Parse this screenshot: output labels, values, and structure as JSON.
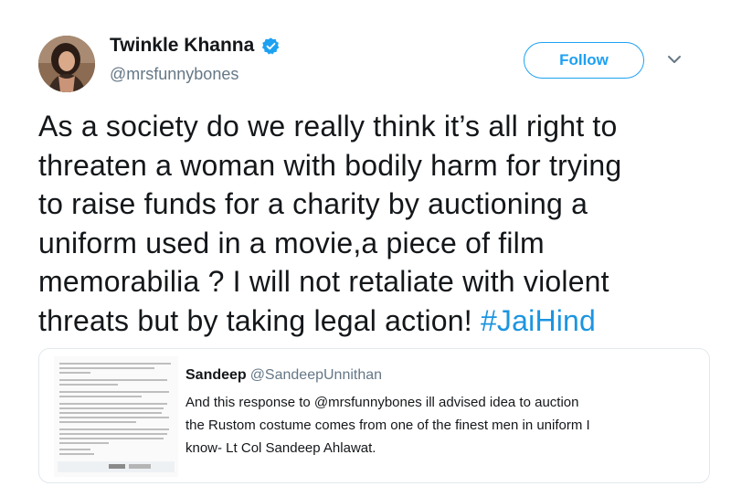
{
  "author": {
    "display_name": "Twinkle Khanna",
    "handle": "@mrsfunnybones",
    "avatar_icon": "profile-photo",
    "verified_icon": "verified-badge-icon",
    "verified_color": "#1da1f2"
  },
  "follow_button": {
    "label": "Follow",
    "color": "#1da1f2"
  },
  "menu": {
    "icon": "chevron-down-icon"
  },
  "tweet": {
    "lines": [
      "As a society do we really think it’s all right to",
      "threaten a woman with bodily harm for trying",
      "to raise funds for a charity by auctioning a",
      "uniform used in a movie,a piece of film",
      "memorabilia ? I will not retaliate with violent",
      "threats but by taking legal action! "
    ],
    "hashtag": "#JaiHind",
    "hashtag_color": "#1b95e0"
  },
  "quoted": {
    "name": "Sandeep",
    "handle": "@SandeepUnnithan",
    "lines": [
      "And this response to @mrsfunnybones  ill advised idea to auction",
      "the Rustom costume comes from one of the finest men in uniform I",
      "know- Lt Col Sandeep Ahlawat."
    ],
    "thumbnail_icon": "letter-screenshot-thumbnail"
  }
}
